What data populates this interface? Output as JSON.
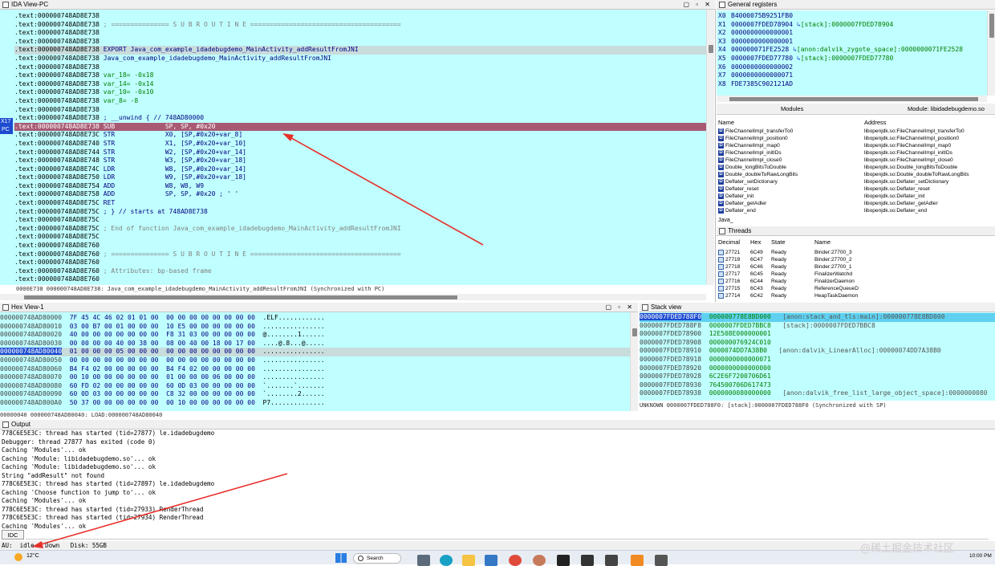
{
  "ida_view": {
    "title": "IDA View-PC",
    "markers": {
      "x17": "X17",
      "pc": "PC"
    },
    "lines": [
      {
        "addr": ".text:000000748AD8E738",
        "rest": "",
        "cls": ""
      },
      {
        "addr": ".text:000000748AD8E738",
        "rest": " ; =============== S U B R O U T I N E =======================================",
        "cls": "gray"
      },
      {
        "addr": ".text:000000748AD8E738",
        "rest": "",
        "cls": ""
      },
      {
        "addr": ".text:000000748AD8E738",
        "rest": "",
        "cls": ""
      },
      {
        "addr": ".text:000000748AD8E738",
        "rest": " EXPORT Java_com_example_idadebugdemo_MainActivity_addResultFromJNI",
        "cls": "blue",
        "hl": true
      },
      {
        "addr": ".text:000000748AD8E738",
        "rest": " Java_com_example_idadebugdemo_MainActivity_addResultFromJNI",
        "cls": "blue"
      },
      {
        "addr": ".text:000000748AD8E738",
        "rest": "",
        "cls": ""
      },
      {
        "addr": ".text:000000748AD8E738",
        "rest": " var_18= -0x18",
        "cls": "green"
      },
      {
        "addr": ".text:000000748AD8E738",
        "rest": " var_14= -0x14",
        "cls": "green"
      },
      {
        "addr": ".text:000000748AD8E738",
        "rest": " var_10= -0x10",
        "cls": "green"
      },
      {
        "addr": ".text:000000748AD8E738",
        "rest": " var_8= -8",
        "cls": "green"
      },
      {
        "addr": ".text:000000748AD8E738",
        "rest": "",
        "cls": ""
      },
      {
        "addr": ".text:000000748AD8E738",
        "rest": " ; __unwind { // 748AD80000",
        "cls": "blue"
      },
      {
        "addr": ".text:000000748AD8E738",
        "rest": " SUB             SP, SP, #0x20",
        "cls": "",
        "pc": true
      },
      {
        "addr": ".text:000000748AD8E73C",
        "rest": " STR             X0, [SP,#0x20+var_8]",
        "cls": "blue"
      },
      {
        "addr": ".text:000000748AD8E740",
        "rest": " STR             X1, [SP,#0x20+var_10]",
        "cls": "blue"
      },
      {
        "addr": ".text:000000748AD8E744",
        "rest": " STR             W2, [SP,#0x20+var_14]",
        "cls": "blue"
      },
      {
        "addr": ".text:000000748AD8E748",
        "rest": " STR             W3, [SP,#0x20+var_18]",
        "cls": "blue"
      },
      {
        "addr": ".text:000000748AD8E74C",
        "rest": " LDR             W8, [SP,#0x20+var_14]",
        "cls": "blue"
      },
      {
        "addr": ".text:000000748AD8E750",
        "rest": " LDR             W9, [SP,#0x20+var_18]",
        "cls": "blue"
      },
      {
        "addr": ".text:000000748AD8E754",
        "rest": " ADD             W8, W8, W9",
        "cls": "blue"
      },
      {
        "addr": ".text:000000748AD8E758",
        "rest": " ADD             SP, SP, #0x20 ; ' '",
        "cls": "blue"
      },
      {
        "addr": ".text:000000748AD8E75C",
        "rest": " RET",
        "cls": "blue"
      },
      {
        "addr": ".text:000000748AD8E75C",
        "rest": " ; } // starts at 748AD8E738",
        "cls": "blue"
      },
      {
        "addr": ".text:000000748AD8E75C",
        "rest": "",
        "cls": ""
      },
      {
        "addr": ".text:000000748AD8E75C",
        "rest": " ; End of function Java_com_example_idadebugdemo_MainActivity_addResultFromJNI",
        "cls": "gray"
      },
      {
        "addr": ".text:000000748AD8E75C",
        "rest": "",
        "cls": ""
      },
      {
        "addr": ".text:000000748AD8E760",
        "rest": "",
        "cls": ""
      },
      {
        "addr": ".text:000000748AD8E760",
        "rest": " ; =============== S U B R O U T I N E =======================================",
        "cls": "gray"
      },
      {
        "addr": ".text:000000748AD8E760",
        "rest": "",
        "cls": ""
      },
      {
        "addr": ".text:000000748AD8E760",
        "rest": " ; Attributes: bp-based frame",
        "cls": "gray"
      },
      {
        "addr": ".text:000000748AD8E760",
        "rest": "",
        "cls": ""
      }
    ],
    "status": "0000E738 000000748AD8E738: Java_com_example_idadebugdemo_MainActivity_addResultFromJNI (Synchronized with PC)"
  },
  "registers": {
    "title": "General registers",
    "rows": [
      {
        "name": "X0",
        "value": "B4000075B9251FB0",
        "extra": ""
      },
      {
        "name": "X1",
        "value": "0000007FDED78904",
        "extra": "[stack]:0000007FDED78904"
      },
      {
        "name": "X2",
        "value": "0000000000000001",
        "extra": ""
      },
      {
        "name": "X3",
        "value": "0000000000000001",
        "extra": ""
      },
      {
        "name": "X4",
        "value": "000000071FE2528",
        "extra": "[anon:dalvik_zygote_space]:0000000071FE2528"
      },
      {
        "name": "X5",
        "value": "0000007FDED77780",
        "extra": "[stack]:0000007FDED77780"
      },
      {
        "name": "X6",
        "value": "0000000000000002",
        "extra": ""
      },
      {
        "name": "X7",
        "value": "0000000000000071",
        "extra": ""
      },
      {
        "name": "X8",
        "value": "FDE7385C902121AD",
        "extra": ""
      }
    ]
  },
  "modules": {
    "title": "Modules",
    "title2": "Module: libidadebugdemo.so",
    "col_name": "Name",
    "col_addr": "Address",
    "rows": [
      {
        "name": "FileChannelImpl_transferTo0",
        "addr": "libopenjdk.so:FileChannelImpl_transferTo0"
      },
      {
        "name": "FileChannelImpl_position0",
        "addr": "libopenjdk.so:FileChannelImpl_position0"
      },
      {
        "name": "FileChannelImpl_map0",
        "addr": "libopenjdk.so:FileChannelImpl_map0"
      },
      {
        "name": "FileChannelImpl_initIDs",
        "addr": "libopenjdk.so:FileChannelImpl_initIDs"
      },
      {
        "name": "FileChannelImpl_close0",
        "addr": "libopenjdk.so:FileChannelImpl_close0"
      },
      {
        "name": "Double_longBitsToDouble",
        "addr": "libopenjdk.so:Double_longBitsToDouble"
      },
      {
        "name": "Double_doubleToRawLongBits",
        "addr": "libopenjdk.so:Double_doubleToRawLongBits"
      },
      {
        "name": "Deflater_setDictionary",
        "addr": "libopenjdk.so:Deflater_setDictionary"
      },
      {
        "name": "Deflater_reset",
        "addr": "libopenjdk.so:Deflater_reset"
      },
      {
        "name": "Deflater_init",
        "addr": "libopenjdk.so:Deflater_init"
      },
      {
        "name": "Deflater_getAdler",
        "addr": "libopenjdk.so:Deflater_getAdler"
      },
      {
        "name": "Deflater_end",
        "addr": "libopenjdk.so:Deflater_end"
      }
    ],
    "filter": "Java_"
  },
  "threads": {
    "title": "Threads",
    "cols": [
      "Decimal",
      "Hex",
      "State",
      "Name"
    ],
    "rows": [
      {
        "dec": "27721",
        "hex": "6C49",
        "state": "Ready",
        "name": "Binder:27700_3"
      },
      {
        "dec": "27719",
        "hex": "6C47",
        "state": "Ready",
        "name": "Binder:27700_2"
      },
      {
        "dec": "27718",
        "hex": "6C46",
        "state": "Ready",
        "name": "Binder:27700_1"
      },
      {
        "dec": "27717",
        "hex": "6C45",
        "state": "Ready",
        "name": "FinalizerWatchd"
      },
      {
        "dec": "27716",
        "hex": "6C44",
        "state": "Ready",
        "name": "FinalizerDaemon"
      },
      {
        "dec": "27715",
        "hex": "6C43",
        "state": "Ready",
        "name": "ReferenceQueueD"
      },
      {
        "dec": "27714",
        "hex": "6C42",
        "state": "Ready",
        "name": "HeapTaskDaemon"
      }
    ]
  },
  "hex_view": {
    "title": "Hex View-1",
    "rows": [
      {
        "addr": "000000748AD80000",
        "bytes": "7F 45 4C 46 02 01 01 00  00 00 00 00 00 00 00 00",
        "ascii": ".ELF............"
      },
      {
        "addr": "000000748AD80010",
        "bytes": "03 00 B7 00 01 00 00 00  10 E5 00 00 00 00 00 00",
        "ascii": "................"
      },
      {
        "addr": "000000748AD80020",
        "bytes": "40 00 00 00 00 00 00 00  F8 31 03 00 00 00 00 00",
        "ascii": "@........1......"
      },
      {
        "addr": "000000748AD80030",
        "bytes": "00 00 00 00 40 00 38 00  08 00 40 00 18 00 17 00",
        "ascii": "....@.8...@....."
      },
      {
        "addr": "000000748AD80040",
        "bytes": "01 00 00 00 05 00 00 00  00 00 00 00 00 00 00 00",
        "ascii": "................",
        "hl": true
      },
      {
        "addr": "000000748AD80050",
        "bytes": "00 00 00 00 00 00 00 00  00 00 00 00 00 00 00 00",
        "ascii": "................"
      },
      {
        "addr": "000000748AD80060",
        "bytes": "B4 F4 02 00 00 00 00 00  B4 F4 02 00 00 00 00 00",
        "ascii": "................"
      },
      {
        "addr": "000000748AD80070",
        "bytes": "00 10 00 00 00 00 00 00  01 00 00 00 06 00 00 00",
        "ascii": "................"
      },
      {
        "addr": "000000748AD80080",
        "bytes": "60 FD 02 00 00 00 00 00  60 0D 03 00 00 00 00 00",
        "ascii": "`.......`......."
      },
      {
        "addr": "000000748AD80090",
        "bytes": "60 0D 03 00 00 00 00 00  C8 32 00 00 00 00 00 00",
        "ascii": "`........2......"
      },
      {
        "addr": "000000748AD800A0",
        "bytes": "50 37 00 00 00 00 00 00  00 10 00 00 00 00 00 00",
        "ascii": "P7.............."
      }
    ],
    "status": "00000040 000000748AD80040: LOAD:000000748AD80040"
  },
  "stack_view": {
    "title": "Stack view",
    "rows": [
      {
        "addr": "0000007FDED788F0",
        "value": "000000778E8BD000",
        "extra": "[anon:stack_and_tls:main]:000000778E8BD000",
        "hl": true
      },
      {
        "addr": "0000007FDED788F8",
        "value": "0000007FDED7BBC8",
        "extra": "[stack]:0000007FDED7BBC8"
      },
      {
        "addr": "0000007FDED78900",
        "value": "12E508E000000001",
        "extra": ""
      },
      {
        "addr": "0000007FDED78908",
        "value": "000000076924C010",
        "extra": ""
      },
      {
        "addr": "0000007FDED78910",
        "value": "0000074DD7A38B0",
        "extra": "[anon:dalvik_LinearAlloc]:00000074DD7A38B0"
      },
      {
        "addr": "0000007FDED78918",
        "value": "0000000000000071",
        "extra": ""
      },
      {
        "addr": "0000007FDED78920",
        "value": "0000000000000000",
        "extra": ""
      },
      {
        "addr": "0000007FDED78928",
        "value": "6C2E6F7200706D61",
        "extra": ""
      },
      {
        "addr": "0000007FDED78930",
        "value": "764500706D617473",
        "extra": ""
      },
      {
        "addr": "0000007FDED78938",
        "value": "0000000080000000",
        "extra": "[anon:dalvik_free_list_large_object_space]:0000000080"
      }
    ],
    "status": "UNKNOWN 0000007FDED788F0: [stack]:0000007FDED788F0 (Synchronized with SP)"
  },
  "output": {
    "title": "Output",
    "lines": [
      "778C6E5E3C: thread has started (tid=27877) le.idadebugdemo",
      "Debugger: thread 27877 has exited (code 0)",
      "Caching 'Modules'... ok",
      "Caching 'Module: libidadebugdemo.so'... ok",
      "Caching 'Module: libidadebugdemo.so'... ok",
      "String \"addResult\" not found",
      "778C6E5E3C: thread has started (tid=27897) le.idadebugdemo",
      "Caching 'Choose function to jump to'... ok",
      "Caching 'Modules'... ok",
      "778C6E5E3C: thread has started (tid=27933) RenderThread",
      "778C6E5E3C: thread has started (tid=27934) RenderThread",
      "Caching 'Modules'... ok"
    ],
    "idc_label": "IDC"
  },
  "statusbar": {
    "text": "AU:  idle   Down   Disk: 55GB"
  },
  "taskbar": {
    "weather": "12°C",
    "search": "Search",
    "time": "10:00 PM",
    "watermark": "@稀土掘金技术社区"
  },
  "colors": {
    "accent_arrow": "#e8302a",
    "cyan_bg": "#c0ffff",
    "pc_line": "#a85a74"
  }
}
